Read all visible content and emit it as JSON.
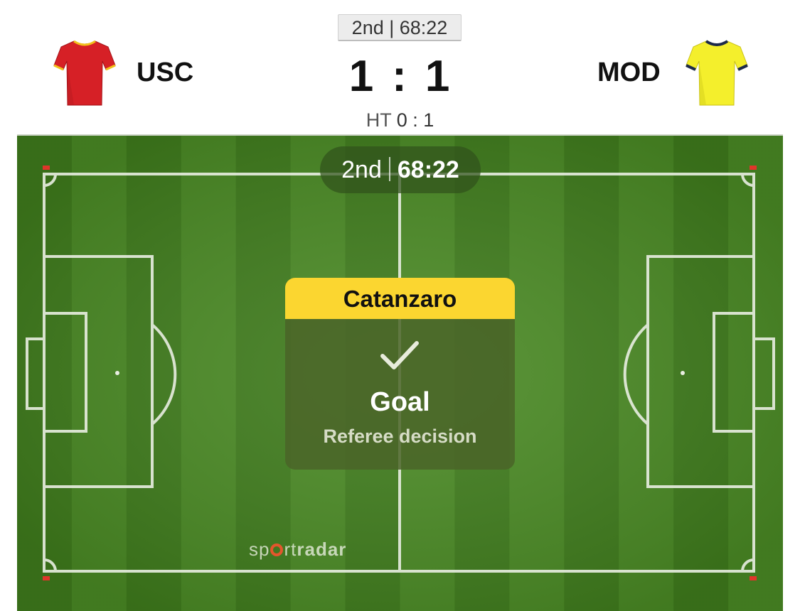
{
  "period_chip": "2nd | 68:22",
  "home_team": {
    "name": "USC",
    "jersey_icon": "red-jersey-icon",
    "jersey_color": "#d62026",
    "trim_color": "#f2c21b"
  },
  "away_team": {
    "name": "MOD",
    "jersey_icon": "yellow-jersey-icon",
    "jersey_color": "#f4ef2c",
    "trim_color": "#1d2a4a"
  },
  "score": {
    "home": "1",
    "separator": ":",
    "away": "1"
  },
  "halftime": {
    "label": "HT",
    "score": "0 : 1"
  },
  "match_clock": {
    "period": "2nd",
    "time": "68:22"
  },
  "event": {
    "team": "Catanzaro",
    "icon": "checkmark-icon",
    "title": "Goal",
    "subtitle": "Referee decision",
    "header_color": "#fbd630"
  },
  "watermark": {
    "part1": "sp",
    "part2": "rt",
    "part3": "radar",
    "accent_color": "#e4562c"
  },
  "pitch_colors": {
    "grass_dark": "#3f7c1c",
    "grass_light": "#4a8a24",
    "lines": "#e9eee2"
  }
}
